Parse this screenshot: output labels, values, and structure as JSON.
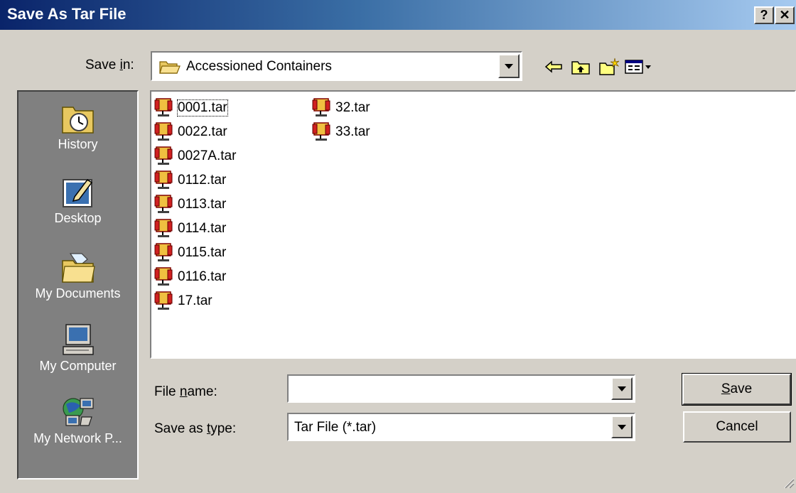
{
  "window": {
    "title": "Save As Tar File",
    "help_btn": "?",
    "close_btn": "✕"
  },
  "save_in": {
    "label_pre": "Save ",
    "label_mnemonic": "i",
    "label_post": "n:",
    "value": "Accessioned Containers"
  },
  "places": [
    {
      "label": "History",
      "icon": "history-icon"
    },
    {
      "label": "Desktop",
      "icon": "desktop-icon"
    },
    {
      "label": "My Documents",
      "icon": "my-documents-icon"
    },
    {
      "label": "My Computer",
      "icon": "my-computer-icon"
    },
    {
      "label": "My Network P...",
      "icon": "my-network-places-icon"
    }
  ],
  "files": [
    {
      "name": "0001.tar",
      "selected": true
    },
    {
      "name": "0022.tar"
    },
    {
      "name": "0027A.tar"
    },
    {
      "name": "0112.tar"
    },
    {
      "name": "0113.tar"
    },
    {
      "name": "0114.tar"
    },
    {
      "name": "0115.tar"
    },
    {
      "name": "0116.tar"
    },
    {
      "name": "17.tar"
    },
    {
      "name": "32.tar"
    },
    {
      "name": "33.tar"
    }
  ],
  "file_name": {
    "label_pre": "File ",
    "label_mnemonic": "n",
    "label_post": "ame:",
    "value": ""
  },
  "save_as_type": {
    "label_pre": "Save as ",
    "label_mnemonic": "t",
    "label_post": "ype:",
    "value": "Tar File (*.tar)"
  },
  "buttons": {
    "save_mnemonic": "S",
    "save_rest": "ave",
    "cancel": "Cancel"
  },
  "colors": {
    "title_start": "#0a246a",
    "title_end": "#a6caf0",
    "dialog_bg": "#d4d0c8",
    "places_bg": "#808080"
  }
}
